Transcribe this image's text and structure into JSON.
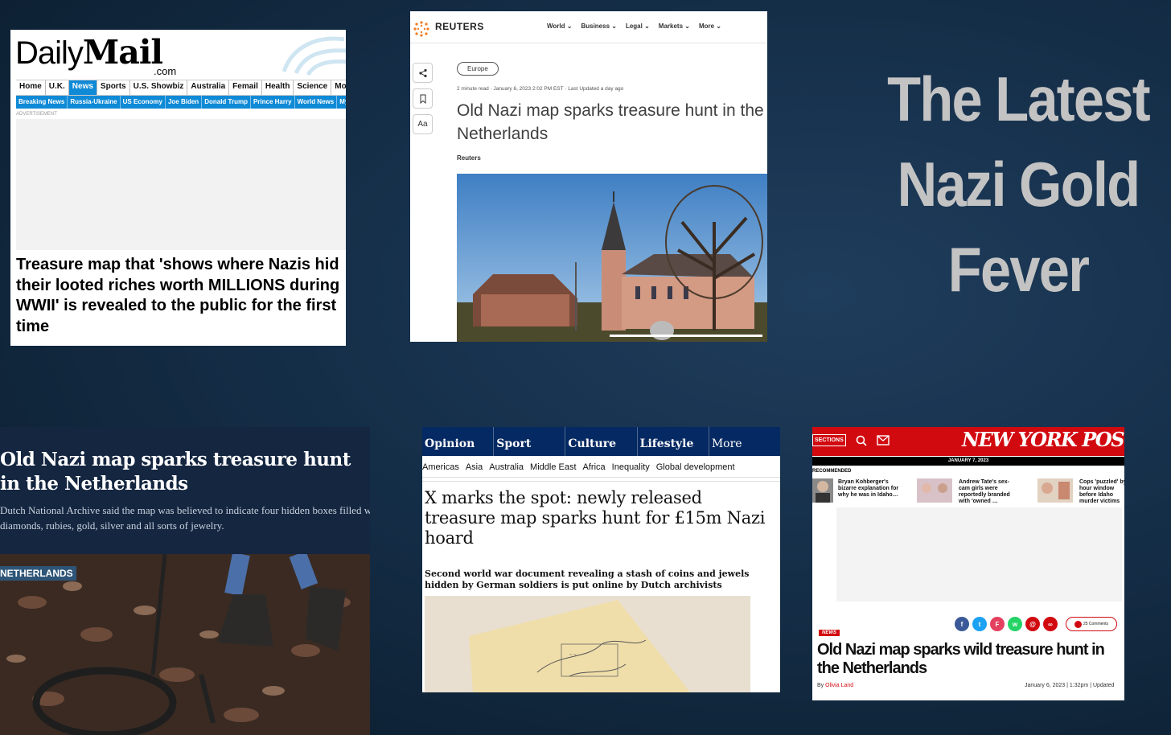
{
  "title": {
    "line1": "The Latest",
    "line2": "Nazi Gold",
    "line3": "Fever"
  },
  "daily_mail": {
    "logo_daily": "Daily",
    "logo_mail": "Mail",
    "logo_dotcom": ".com",
    "nav": [
      "Home",
      "U.K.",
      "News",
      "Sports",
      "U.S. Showbiz",
      "Australia",
      "Femail",
      "Health",
      "Science",
      "Money"
    ],
    "subnav": [
      "Breaking News",
      "Russia-Ukraine",
      "US Economy",
      "Joe Biden",
      "Donald Trump",
      "Prince Harry",
      "World News",
      "My Profile"
    ],
    "ad_label": "ADVERTISEMENT",
    "headline": "Treasure map that 'shows where Nazis hid their looted riches worth MILLIONS during WWII' is revealed to the public for the first time"
  },
  "reuters": {
    "brand": "REUTERS",
    "nav": [
      "World ⌄",
      "Business ⌄",
      "Legal ⌄",
      "Markets ⌄",
      "More ⌄"
    ],
    "side_font": "Aa",
    "section": "Europe",
    "meta": "2 minute read · January 6, 2023 2:02 PM EST · Last Updated a day ago",
    "headline": "Old Nazi map sparks treasure hunt in the Netherlands",
    "byline": "Reuters"
  },
  "left_bottom": {
    "headline": "Old Nazi map sparks treasure hunt in the Netherlands",
    "subtitle_line1": "Dutch National Archive said the map was believed to indicate four hidden boxes filled with",
    "subtitle_line2": "diamonds, rubies, gold, silver and all sorts of jewelry.",
    "tag": "NETHERLANDS"
  },
  "guardian": {
    "nav": [
      "Opinion",
      "Sport",
      "Culture",
      "Lifestyle",
      "More"
    ],
    "subnav": [
      "Americas",
      "Asia",
      "Australia",
      "Middle East",
      "Africa",
      "Inequality",
      "Global development"
    ],
    "headline": "X marks the spot: newly released treasure map sparks hunt for £15m Nazi hoard",
    "standfirst": "Second world war document revealing a stash of coins and jewels hidden by German soldiers is put online by Dutch archivists"
  },
  "ny_post": {
    "sections": "SECTIONS",
    "logo": "NEW YORK POST",
    "date": "JANUARY 7, 2023",
    "recommended": "RECOMMENDED",
    "items": [
      "Bryan Kohberger's bizarre explanation for why he was in Idaho…",
      "Andrew Tate's sex-cam girls were reportedly branded with 'owned …",
      "Cops 'puzzled' by hour window before Idaho murder victims"
    ],
    "comments": "25 Comments",
    "badge": "NEWS",
    "headline": "Old Nazi map sparks wild treasure hunt in the Netherlands",
    "by_prefix": "By",
    "author": "Olivia Land",
    "timestamp": "January 6, 2023 | 1:32pm | Updated"
  },
  "colors": {
    "background": "#16304b",
    "title": "#c3c3c3",
    "dm_blue": "#0f8ad6",
    "guardian_navy": "#052962",
    "nypost_red": "#d10a10"
  }
}
